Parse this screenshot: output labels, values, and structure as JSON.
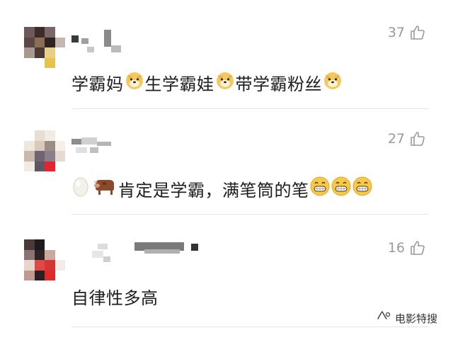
{
  "comments": [
    {
      "likes": "37",
      "segments": [
        "学霸妈",
        "生学霸娃",
        "带学霸粉丝"
      ]
    },
    {
      "likes": "27",
      "text": "肯定是学霸，满笔筒的笔"
    },
    {
      "likes": "16",
      "text": "自律性多高"
    }
  ],
  "watermark": {
    "label": "电影特搜"
  },
  "icons": {
    "like": "thumbs-up-outline-icon",
    "doge": "doge-emoji-icon",
    "egg": "egg-emoji-icon",
    "cow": "cow-emoji-icon",
    "grin": "grinning-face-emoji-icon",
    "wechat": "wechat-channel-icon"
  },
  "colors": {
    "text": "#1d1d1d",
    "muted": "#9a9a9a",
    "divider": "#e4e4e4",
    "emoji": "#f7c948"
  }
}
